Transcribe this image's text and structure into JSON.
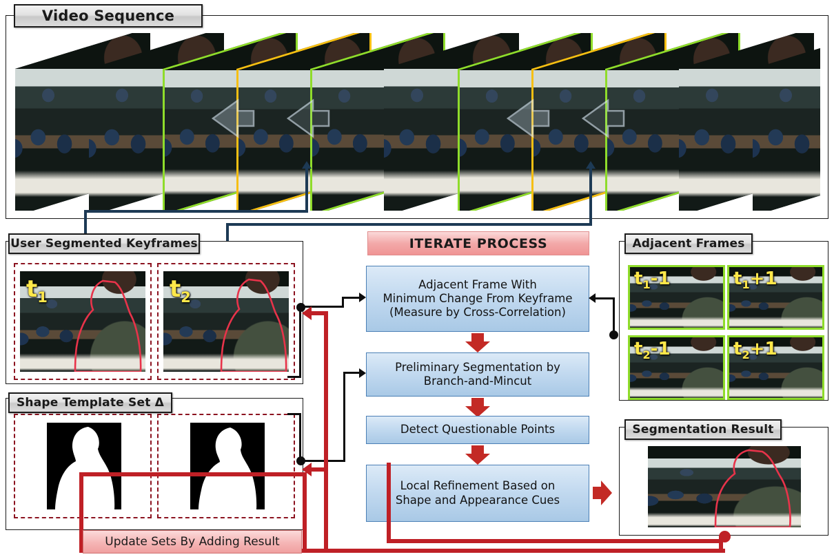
{
  "panels": {
    "video_sequence": {
      "title": "Video Sequence"
    },
    "user_keyframes": {
      "title": "User Segmented Keyframes"
    },
    "shape_template": {
      "title": "Shape Template Set Δ"
    },
    "adjacent_frames": {
      "title": "Adjacent Frames"
    },
    "segmentation_result": {
      "title": "Segmentation Result"
    }
  },
  "iterate": {
    "header": "ITERATE PROCESS",
    "steps": [
      {
        "label": "Adjacent Frame With\nMinimum Change From Keyframe\n(Measure by Cross-Correlation)"
      },
      {
        "label": "Preliminary Segmentation by\nBranch-and-Mincut"
      },
      {
        "label": "Detect Questionable Points"
      },
      {
        "label": "Local Refinement Based on\nShape and Appearance Cues"
      }
    ]
  },
  "update_box": {
    "label": "Update Sets By Adding Result"
  },
  "keyframes": [
    {
      "label": "t",
      "sub": "1"
    },
    {
      "label": "t",
      "sub": "2"
    }
  ],
  "adjacent_thumbs": [
    {
      "label": "t",
      "sub": "1",
      "offset": "-1"
    },
    {
      "label": "t",
      "sub": "1",
      "offset": "+1"
    },
    {
      "label": "t",
      "sub": "2",
      "offset": "-1"
    },
    {
      "label": "t",
      "sub": "2",
      "offset": "+1"
    }
  ],
  "filmstrip": {
    "frame_count": 11,
    "frame_roles": [
      "plain",
      "plain",
      "green",
      "amber",
      "green",
      "plain",
      "green",
      "amber",
      "green",
      "plain",
      "plain"
    ],
    "keyframe_indices": [
      3,
      7
    ],
    "adjacent_indices": [
      2,
      4,
      6,
      8
    ]
  },
  "colors": {
    "keyframe_border": "#f6bf12",
    "adjacent_border": "#8fdc2b",
    "process_box": "#c3daf0",
    "process_border": "#4a7fb5",
    "iterate_header": "#f3a9a9",
    "feedback_red": "#bf2026",
    "arrow_red": "#c32a25",
    "connector_navy": "#1d3a55",
    "dashed_red": "#8c1320",
    "panel_border": "#1a1a1a",
    "tab_text": "#1a1a1a",
    "frame_label_yellow": "#ffe84a"
  }
}
